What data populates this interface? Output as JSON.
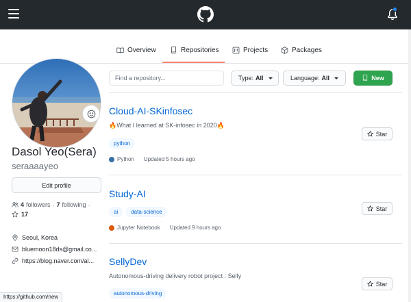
{
  "topbar": {
    "menu_icon": "hamburger-icon",
    "logo_icon": "github-mark-icon",
    "notification_icon": "bell-icon",
    "notification_dot_color": "#2188ff"
  },
  "tabs": [
    {
      "label": "Overview",
      "icon": "book-open-icon",
      "active": false
    },
    {
      "label": "Repositories",
      "icon": "repo-icon",
      "active": true
    },
    {
      "label": "Projects",
      "icon": "project-icon",
      "active": false
    },
    {
      "label": "Packages",
      "icon": "package-icon",
      "active": false
    }
  ],
  "profile": {
    "fullname": "Dasol Yeo(Sera)",
    "username": "seraaaayeo",
    "edit_label": "Edit profile",
    "followers_count": "4",
    "followers_label": "followers",
    "following_count": "7",
    "following_label": "following",
    "separator": "·",
    "stars_count": "17",
    "location": "Seoul, Korea",
    "email": "bluemoon18ds@gmail.co...",
    "website": "https://blog.naver.com/al..."
  },
  "toolbar": {
    "search_placeholder": "Find a repository...",
    "type_label": "Type:",
    "type_value": "All",
    "language_label": "Language:",
    "language_value": "All",
    "new_label": "New"
  },
  "repos": [
    {
      "name": "Cloud-AI-SKinfosec",
      "description": "🔥What I learned at SK-infosec in 2020🔥",
      "topics": [
        "python"
      ],
      "language": "Python",
      "language_color": "#3572A5",
      "updated": "Updated 5 hours ago",
      "star_label": "Star"
    },
    {
      "name": "Study-AI",
      "description": "",
      "topics": [
        "ai",
        "data-science"
      ],
      "language": "Jupyter Notebook",
      "language_color": "#DA5B0B",
      "updated": "Updated 9 hours ago",
      "star_label": "Star"
    },
    {
      "name": "SellyDev",
      "description": "Autonomous-driving delivery robot project : Selly",
      "topics": [
        "autonomous-driving"
      ],
      "language": "",
      "language_color": "",
      "updated": "",
      "star_label": "Star"
    }
  ],
  "statusbar": {
    "url": "https://github.com/new"
  },
  "colors": {
    "accent_link": "#0366d6",
    "tab_underline": "#f9826c",
    "new_button": "#2ea44f",
    "topbar": "#24292e"
  }
}
